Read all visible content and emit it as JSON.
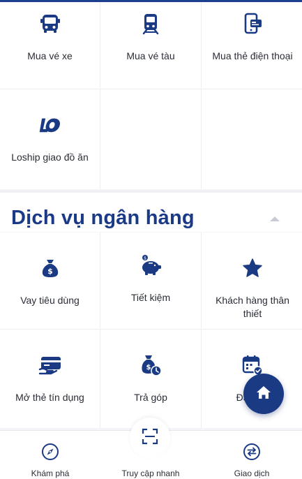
{
  "colors": {
    "primary": "#1b3a84",
    "background": "#f4f5f8"
  },
  "top_services": [
    {
      "label": "Mua vé xe",
      "icon": "bus-icon"
    },
    {
      "label": "Mua vé tàu",
      "icon": "train-icon"
    },
    {
      "label": "Mua thẻ điện thoại",
      "icon": "phone-card-icon"
    },
    {
      "label": "Loship giao đồ ăn",
      "icon": "loship-logo-icon"
    }
  ],
  "bank_section": {
    "title": "Dịch vụ ngân hàng",
    "items": [
      {
        "label": "Vay tiêu dùng",
        "icon": "money-bag-icon"
      },
      {
        "label": "Tiết kiệm",
        "icon": "piggy-bank-icon"
      },
      {
        "label": "Khách hàng thân thiết",
        "icon": "star-icon"
      },
      {
        "label": "Mở thẻ tín dụng",
        "icon": "credit-card-icon"
      },
      {
        "label": "Trả góp",
        "icon": "installment-icon"
      },
      {
        "label": "Đặt lịch",
        "icon": "calendar-check-icon"
      }
    ]
  },
  "fab": {
    "icon": "home-icon"
  },
  "bottom_nav": [
    {
      "label": "Khám phá",
      "icon": "compass-icon"
    },
    {
      "label": "Truy cập nhanh",
      "icon": "scan-icon"
    },
    {
      "label": "Giao dịch",
      "icon": "exchange-icon"
    }
  ]
}
